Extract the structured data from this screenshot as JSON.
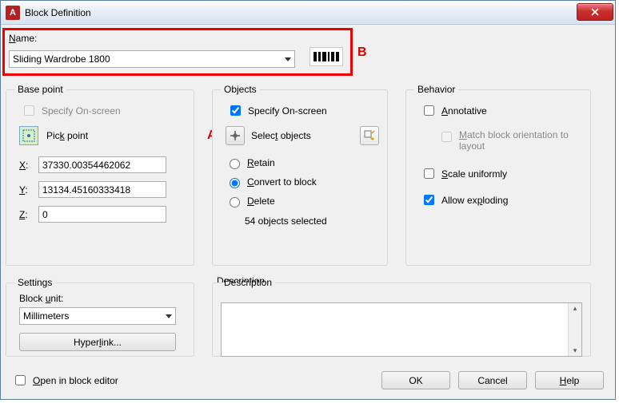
{
  "window": {
    "title": "Block Definition"
  },
  "annotations": {
    "A": "A",
    "B": "B"
  },
  "name": {
    "label_html": "Name",
    "value": "Sliding Wardrobe 1800"
  },
  "basepoint": {
    "legend": "Base point",
    "specify": "Specify On-screen",
    "pick": "Pick point",
    "x_label": "X:",
    "x": "37330.00354462062",
    "y_label": "Y:",
    "y": "13134.45160333418",
    "z_label": "Z:",
    "z": "0"
  },
  "objects": {
    "legend": "Objects",
    "specify": "Specify On-screen",
    "select": "Select objects",
    "retain": "Retain",
    "convert": "Convert to block",
    "delete": "Delete",
    "status": "54 objects selected"
  },
  "behavior": {
    "legend": "Behavior",
    "annotative": "Annotative",
    "match": "Match block orientation to layout",
    "scale": "Scale uniformly",
    "explode": "Allow exploding"
  },
  "settings": {
    "legend": "Settings",
    "unit_label_html": "Block unit:",
    "unit_value": "Millimeters",
    "hyperlink": "Hyperlink..."
  },
  "description": {
    "legend": "Description",
    "value": ""
  },
  "footer": {
    "open": "Open in block editor",
    "ok": "OK",
    "cancel": "Cancel",
    "help": "Help"
  }
}
